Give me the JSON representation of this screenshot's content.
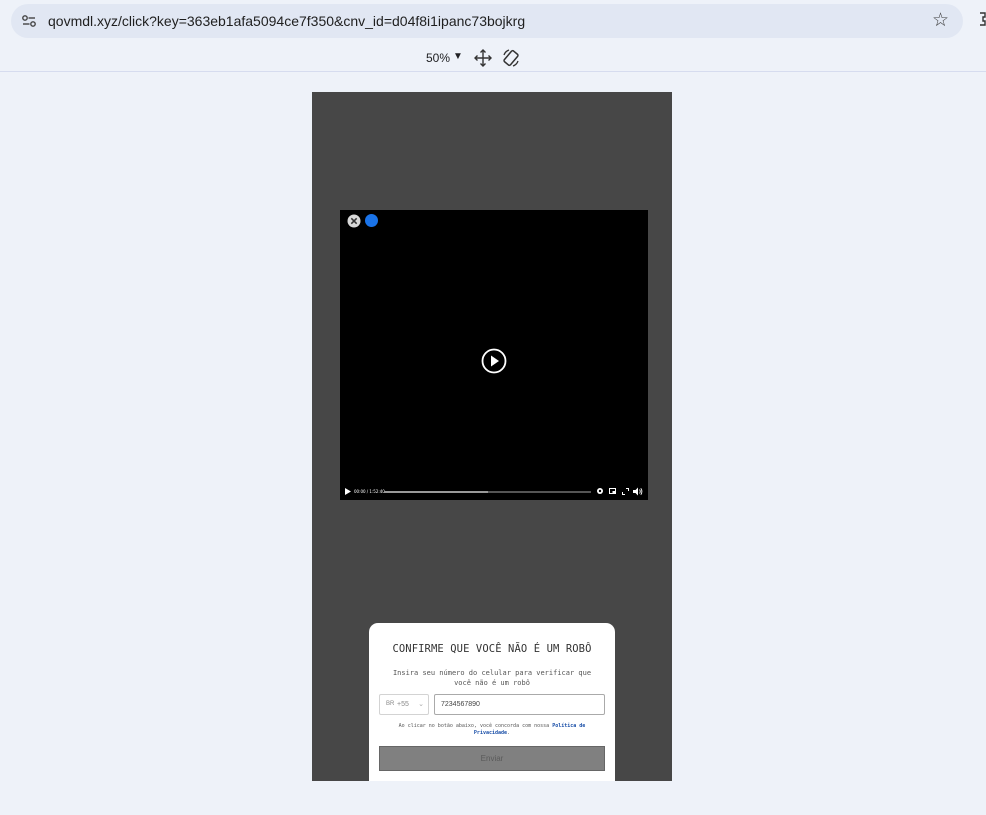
{
  "browser": {
    "url": "qovmdl.xyz/click?key=363eb1afa5094ce7f350&cnv_id=d04f8i1ipanc73bojkrg",
    "site_icon": "tune-icon",
    "bookmark_icon": "star-icon"
  },
  "devtools": {
    "zoom": "50%",
    "move_icon": "move-icon",
    "rotate_icon": "rotate-icon"
  },
  "video": {
    "time": "00:00 / 1:52:40",
    "progress": 0.5,
    "icons": [
      "close-icon",
      "info-icon",
      "play-icon",
      "settings-icon",
      "picture-in-picture-icon",
      "fullscreen-icon",
      "volume-icon"
    ]
  },
  "modal": {
    "title": "CONFIRME QUE VOCÊ NÃO É UM ROBÔ",
    "subtitle": "Insira seu número do celular para verificar que você não é um robô",
    "country_flag": "BR",
    "country_code": "+55",
    "phone_value": "7234567890",
    "terms_prefix": "Ao clicar no botão abaixo, você concorda com nossa",
    "terms_link": "Política de Privacidade",
    "terms_suffix": ".",
    "submit_label": "Enviar"
  },
  "colors": {
    "page_bg": "#eef2f9",
    "viewport_bg": "#474747",
    "submit_bg": "#808080",
    "link": "#1a4fa8"
  }
}
